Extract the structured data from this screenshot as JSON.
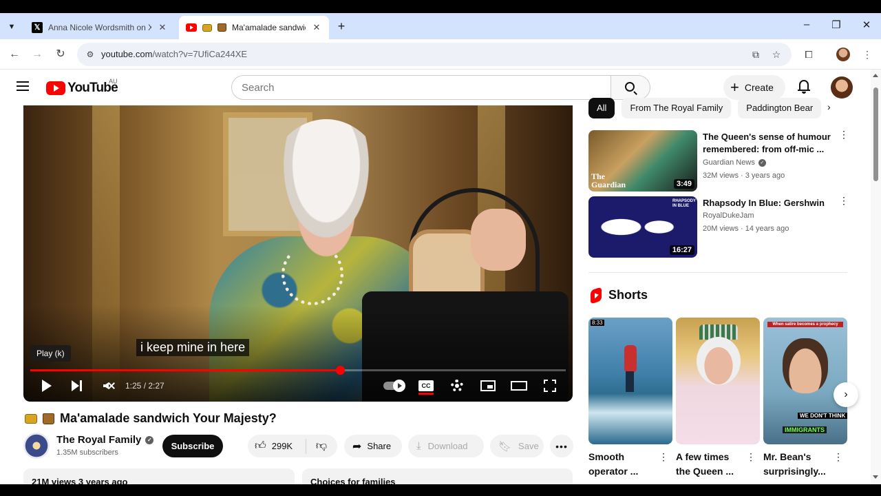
{
  "browser": {
    "tabs": [
      {
        "title": "Anna Nicole Wordsmith on X: \"",
        "favicon": "x-logo-icon"
      },
      {
        "title": "Ma'amalade sandwich Y",
        "favicon": "youtube-favicon"
      }
    ],
    "close_glyph": "✕",
    "new_tab_glyph": "+",
    "url_domain": "youtube.com",
    "url_path": "/watch?v=7UfiCa244XE"
  },
  "header": {
    "logo_text": "YouTube",
    "country_code": "AU",
    "search_placeholder": "Search",
    "create_label": "Create"
  },
  "player": {
    "caption": "i keep mine in here",
    "tooltip": "Play (k)",
    "time_current": "1:25",
    "time_total": "2:27",
    "progress": 0.578,
    "cc_label": "CC"
  },
  "video": {
    "title": "Ma'amalade sandwich Your Majesty?",
    "channel": "The Royal Family",
    "subscribers": "1.35M subscribers",
    "subscribe_label": "Subscribe",
    "likes": "299K",
    "share_label": "Share",
    "download_label": "Download",
    "save_label": "Save",
    "description_stats": "21M views  3 years ago",
    "description_chapter": "Choices for families"
  },
  "sidebar": {
    "chips": [
      "All",
      "From The Royal Family",
      "Paddington Bear"
    ],
    "recommendations": [
      {
        "title": "The Queen's sense of humour remembered: from off-mic ...",
        "channel": "Guardian News",
        "verified": true,
        "meta": "32M views · 3 years ago",
        "duration": "3:49",
        "thumb_text": "The Guardian"
      },
      {
        "title": "Rhapsody In Blue: Gershwin",
        "channel": "RoyalDukeJam",
        "verified": false,
        "meta": "20M views · 14 years ago",
        "duration": "16:27",
        "thumb_text": "RHAPSODY IN BLUE"
      }
    ],
    "shorts_title": "Shorts",
    "shorts": [
      {
        "title": "Smooth operator ...",
        "badge": "8:33"
      },
      {
        "title": "A few times the Queen ...",
        "badge": ""
      },
      {
        "title": "Mr. Bean's surprisingly...",
        "badge": "When satire becomes a prophecy",
        "overlay_1": "WE DON'T THINK",
        "overlay_2": "IMMIGRANTS"
      }
    ]
  },
  "colors": {
    "accent": "#ff0000",
    "tab_strip": "#d3e3fd",
    "chip_active": "#0f0f0f"
  }
}
